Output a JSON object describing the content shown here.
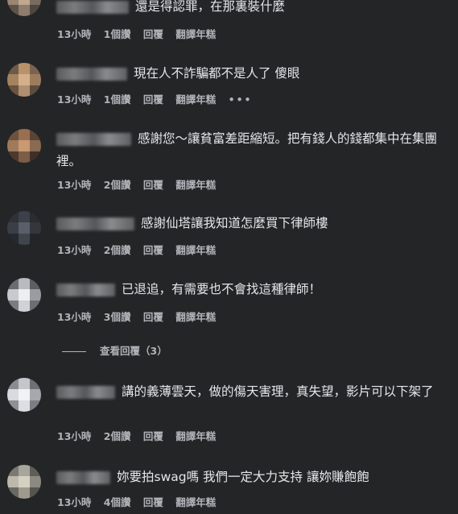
{
  "comments": [
    {
      "text": "還是得認罪，在那裏裝什麼",
      "time": "13小時",
      "likes": "1個讚",
      "reply": "回覆",
      "translate": "翻譯年糕",
      "more": ""
    },
    {
      "text": "現在人不詐騙都不是人了 傻眼",
      "time": "13小時",
      "likes": "1個讚",
      "reply": "回覆",
      "translate": "翻譯年糕",
      "more": "•••"
    },
    {
      "text": "感謝您～讓貧富差距縮短。把有錢人的錢都集中在集團裡。",
      "time": "13小時",
      "likes": "2個讚",
      "reply": "回覆",
      "translate": "翻譯年糕",
      "more": ""
    },
    {
      "text": "感謝仙塔讓我知道怎麼買下律師樓",
      "time": "13小時",
      "likes": "2個讚",
      "reply": "回覆",
      "translate": "翻譯年糕",
      "more": ""
    },
    {
      "text": "已退追，有需要也不會找這種律師！",
      "time": "13小時",
      "likes": "3個讚",
      "reply": "回覆",
      "translate": "翻譯年糕",
      "more": ""
    },
    {
      "text": "講的義薄雲天，做的傷天害理，真失望，影片可以下架了",
      "time": "13小時",
      "likes": "2個讚",
      "reply": "回覆",
      "translate": "翻譯年糕",
      "more": ""
    },
    {
      "text": "妳要拍swag嗎 我們一定大力支持 讓妳賺飽飽",
      "time": "13小時",
      "likes": "4個讚",
      "reply": "回覆",
      "translate": "翻譯年糕",
      "more": ""
    }
  ],
  "view_replies": "查看回覆（3）",
  "colors": {
    "background": "#242526",
    "text": "#e4e6eb",
    "meta": "#b0b3b8"
  }
}
